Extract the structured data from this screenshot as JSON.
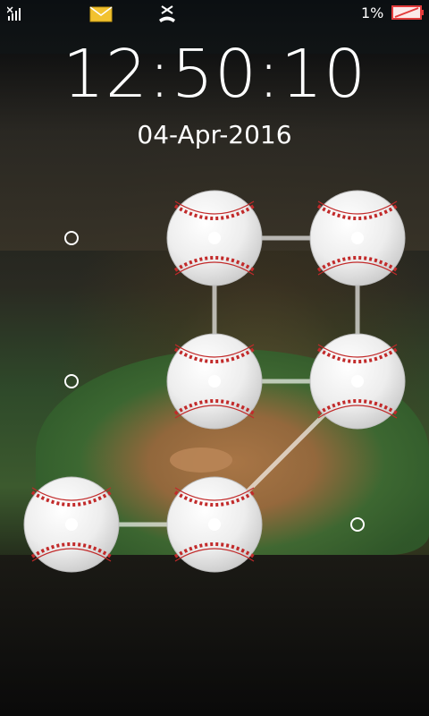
{
  "status_bar": {
    "battery_text": "1%",
    "battery_color": "#e23b3b",
    "signal_icon": "signal-icon",
    "mail_icon": "mail-icon",
    "missed_call_icon": "missed-call-icon"
  },
  "lock": {
    "time": "12:50:10",
    "date": "04-Apr-2016"
  },
  "pattern": {
    "grid_size": 3,
    "ball_color": "#f2f2f2",
    "stitch_color": "#c22a2a",
    "line_color": "#ffffff",
    "balls_visible": [
      2,
      3,
      5,
      6,
      7,
      8
    ],
    "dots_visible": [
      1,
      4,
      9
    ],
    "path": [
      7,
      8,
      6,
      5,
      2,
      3,
      6
    ]
  }
}
